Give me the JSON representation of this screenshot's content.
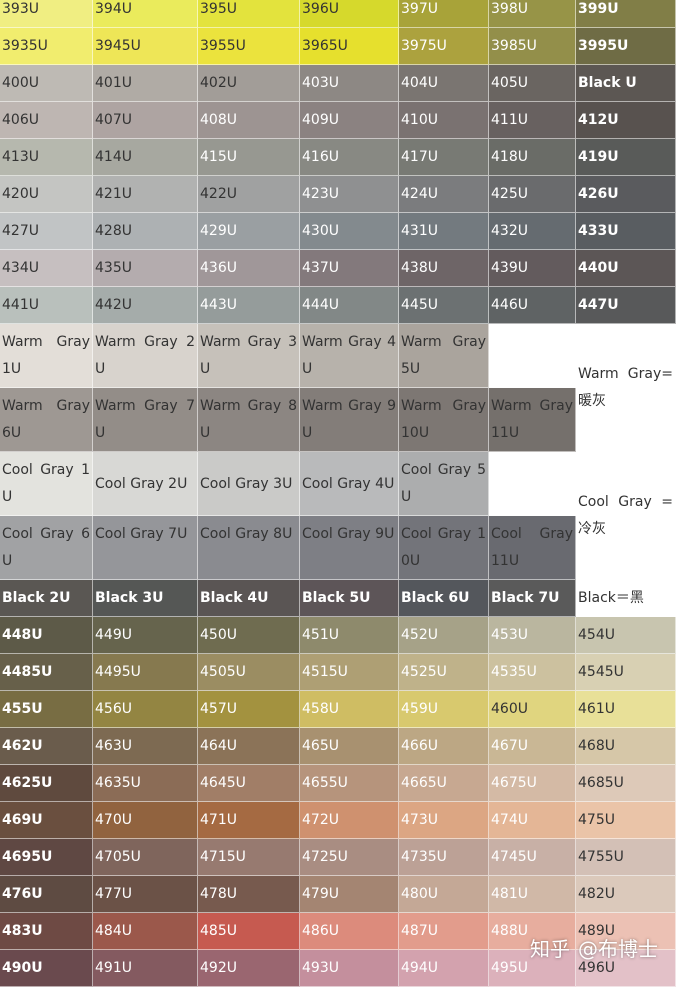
{
  "columns": 7,
  "rows": [
    {
      "cells": [
        {
          "label": "393U",
          "bg": "#f0ee82",
          "text": "light"
        },
        {
          "label": "394U",
          "bg": "#eaeb5c",
          "text": "light"
        },
        {
          "label": "395U",
          "bg": "#e3e33d",
          "text": "light"
        },
        {
          "label": "396U",
          "bg": "#d6d92c",
          "text": "light"
        },
        {
          "label": "397U",
          "bg": "#a8a339",
          "text": "dark"
        },
        {
          "label": "398U",
          "bg": "#979447",
          "text": "dark"
        },
        {
          "label": "399U",
          "bg": "#817e47",
          "text": "dark",
          "bold": true
        }
      ]
    },
    {
      "cells": [
        {
          "label": "3935U",
          "bg": "#f1ed6e",
          "text": "light"
        },
        {
          "label": "3945U",
          "bg": "#eee657",
          "text": "light"
        },
        {
          "label": "3955U",
          "bg": "#ebe33d",
          "text": "light"
        },
        {
          "label": "3965U",
          "bg": "#e6e02d",
          "text": "light"
        },
        {
          "label": "3975U",
          "bg": "#aca23e",
          "text": "dark"
        },
        {
          "label": "3985U",
          "bg": "#938f4a",
          "text": "dark"
        },
        {
          "label": "3995U",
          "bg": "#6f6c45",
          "text": "dark",
          "bold": true
        }
      ]
    },
    {
      "cells": [
        {
          "label": "400U",
          "bg": "#bebab4",
          "text": "light"
        },
        {
          "label": "401U",
          "bg": "#b0aba5",
          "text": "light"
        },
        {
          "label": "402U",
          "bg": "#a29d98",
          "text": "light"
        },
        {
          "label": "403U",
          "bg": "#8d8884",
          "text": "dark"
        },
        {
          "label": "404U",
          "bg": "#7a7571",
          "text": "dark"
        },
        {
          "label": "405U",
          "bg": "#6a6561",
          "text": "dark"
        },
        {
          "label": "Black U",
          "bg": "#5c5753",
          "text": "dark",
          "bold": true
        }
      ]
    },
    {
      "cells": [
        {
          "label": "406U",
          "bg": "#beb6b2",
          "text": "light"
        },
        {
          "label": "407U",
          "bg": "#aea4a2",
          "text": "light"
        },
        {
          "label": "408U",
          "bg": "#9d9492",
          "text": "dark"
        },
        {
          "label": "409U",
          "bg": "#8b8281",
          "text": "dark"
        },
        {
          "label": "410U",
          "bg": "#7a7271",
          "text": "dark"
        },
        {
          "label": "411U",
          "bg": "#686160",
          "text": "dark"
        },
        {
          "label": "412U",
          "bg": "#58524f",
          "text": "dark",
          "bold": true
        }
      ]
    },
    {
      "cells": [
        {
          "label": "413U",
          "bg": "#b6b8ae",
          "text": "light"
        },
        {
          "label": "414U",
          "bg": "#a7a8a0",
          "text": "light"
        },
        {
          "label": "415U",
          "bg": "#979891",
          "text": "dark"
        },
        {
          "label": "416U",
          "bg": "#888983",
          "text": "dark"
        },
        {
          "label": "417U",
          "bg": "#787a74",
          "text": "dark"
        },
        {
          "label": "418U",
          "bg": "#6a6c67",
          "text": "dark"
        },
        {
          "label": "419U",
          "bg": "#595b59",
          "text": "dark",
          "bold": true
        }
      ]
    },
    {
      "cells": [
        {
          "label": "420U",
          "bg": "#c4c5c2",
          "text": "light"
        },
        {
          "label": "421U",
          "bg": "#b1b2b1",
          "text": "light"
        },
        {
          "label": "422U",
          "bg": "#a0a1a1",
          "text": "light"
        },
        {
          "label": "423U",
          "bg": "#8f9091",
          "text": "dark"
        },
        {
          "label": "424U",
          "bg": "#7b7c7e",
          "text": "dark"
        },
        {
          "label": "425U",
          "bg": "#6a6b6d",
          "text": "dark"
        },
        {
          "label": "426U",
          "bg": "#5a5b5e",
          "text": "dark",
          "bold": true
        }
      ]
    },
    {
      "cells": [
        {
          "label": "427U",
          "bg": "#c1c4c5",
          "text": "light"
        },
        {
          "label": "428U",
          "bg": "#adb1b3",
          "text": "light"
        },
        {
          "label": "429U",
          "bg": "#9a9fa2",
          "text": "dark"
        },
        {
          "label": "430U",
          "bg": "#838a8e",
          "text": "dark"
        },
        {
          "label": "431U",
          "bg": "#737a7f",
          "text": "dark"
        },
        {
          "label": "432U",
          "bg": "#656b70",
          "text": "dark"
        },
        {
          "label": "433U",
          "bg": "#595d61",
          "text": "dark",
          "bold": true
        }
      ]
    },
    {
      "cells": [
        {
          "label": "434U",
          "bg": "#c6bfc0",
          "text": "light"
        },
        {
          "label": "435U",
          "bg": "#b4acae",
          "text": "light"
        },
        {
          "label": "436U",
          "bg": "#a09799",
          "text": "dark"
        },
        {
          "label": "437U",
          "bg": "#83797c",
          "text": "dark"
        },
        {
          "label": "438U",
          "bg": "#6e6567",
          "text": "dark"
        },
        {
          "label": "439U",
          "bg": "#635b5d",
          "text": "dark"
        },
        {
          "label": "440U",
          "bg": "#5c5656",
          "text": "dark",
          "bold": true
        }
      ]
    },
    {
      "cells": [
        {
          "label": "441U",
          "bg": "#b9c0bc",
          "text": "light"
        },
        {
          "label": "442U",
          "bg": "#a5acaa",
          "text": "light"
        },
        {
          "label": "443U",
          "bg": "#959c9b",
          "text": "dark"
        },
        {
          "label": "444U",
          "bg": "#828887",
          "text": "dark"
        },
        {
          "label": "445U",
          "bg": "#6c7172",
          "text": "dark"
        },
        {
          "label": "446U",
          "bg": "#5f6364",
          "text": "dark"
        },
        {
          "label": "447U",
          "bg": "#58595a",
          "text": "dark",
          "bold": true
        }
      ]
    }
  ],
  "grays": [
    {
      "cells": [
        {
          "label": "Warm Gray 1U",
          "bg": "#e3ded8",
          "text": "light"
        },
        {
          "label": "Warm Gray 2U",
          "bg": "#d8d3cd",
          "text": "light"
        },
        {
          "label": "Warm Gray 3U",
          "bg": "#c6c1ba",
          "text": "light"
        },
        {
          "label": "Warm Gray 4U",
          "bg": "#b7b2ab",
          "text": "light"
        },
        {
          "label": "Warm Gray 5U",
          "bg": "#aaa49d",
          "text": "light"
        },
        {
          "label": "",
          "bg": "#ffffff",
          "text": "light"
        },
        {
          "label": "Warm Gray=暖灰",
          "bg": "#ffffff",
          "text": "light",
          "span": 2
        }
      ]
    },
    {
      "cells": [
        {
          "label": "Warm Gray 6U",
          "bg": "#9e9893",
          "text": "light"
        },
        {
          "label": "Warm Gray 7U",
          "bg": "#938d88",
          "text": "light"
        },
        {
          "label": "Warm Gray 8U",
          "bg": "#8c8682",
          "text": "light"
        },
        {
          "label": "Warm Gray 9U",
          "bg": "#837d79",
          "text": "light"
        },
        {
          "label": "Warm Gray 10U",
          "bg": "#7d7773",
          "text": "light"
        },
        {
          "label": "Warm Gray 11U",
          "bg": "#75706c",
          "text": "light"
        }
      ]
    },
    {
      "cells": [
        {
          "label": "Cool Gray 1U",
          "bg": "#e3e3de",
          "text": "light"
        },
        {
          "label": "Cool Gray 2U",
          "bg": "#d8d8d5",
          "text": "light"
        },
        {
          "label": "Cool Gray 3U",
          "bg": "#cacac8",
          "text": "light"
        },
        {
          "label": "Cool Gray 4U",
          "bg": "#b9babb",
          "text": "light"
        },
        {
          "label": "Cool Gray 5U",
          "bg": "#acadae",
          "text": "light"
        },
        {
          "label": "",
          "bg": "#ffffff",
          "text": "light"
        },
        {
          "label": "Cool Gray =冷灰",
          "bg": "#ffffff",
          "text": "light",
          "span": 2
        }
      ]
    },
    {
      "cells": [
        {
          "label": "Cool Gray 6U",
          "bg": "#a1a2a4",
          "text": "light"
        },
        {
          "label": "Cool Gray 7U",
          "bg": "#95969a",
          "text": "light"
        },
        {
          "label": "Cool Gray 8U",
          "bg": "#8a8b90",
          "text": "light"
        },
        {
          "label": "Cool Gray 9U",
          "bg": "#7e7f85",
          "text": "light"
        },
        {
          "label": "Cool Gray 10U",
          "bg": "#73747a",
          "text": "light"
        },
        {
          "label": "Cool Gray 11U",
          "bg": "#696a70",
          "text": "light"
        }
      ]
    },
    {
      "cells": [
        {
          "label": "Black 2U",
          "bg": "#5a5753",
          "text": "dark",
          "bold": true
        },
        {
          "label": "Black 3U",
          "bg": "#555755",
          "text": "dark",
          "bold": true
        },
        {
          "label": "Black 4U",
          "bg": "#5a5554",
          "text": "dark",
          "bold": true
        },
        {
          "label": "Black 5U",
          "bg": "#5d5558",
          "text": "dark",
          "bold": true
        },
        {
          "label": "Black 6U",
          "bg": "#54575c",
          "text": "dark",
          "bold": true
        },
        {
          "label": "Black 7U",
          "bg": "#5a5a5a",
          "text": "dark",
          "bold": true
        },
        {
          "label": "Black＝黑",
          "bg": "#ffffff",
          "text": "light"
        }
      ]
    }
  ],
  "bottom": [
    {
      "cells": [
        {
          "label": "448U",
          "bg": "#5d5a48",
          "text": "dark",
          "bold": true
        },
        {
          "label": "449U",
          "bg": "#66644d",
          "text": "dark"
        },
        {
          "label": "450U",
          "bg": "#6f6c50",
          "text": "dark"
        },
        {
          "label": "451U",
          "bg": "#8e8a6c",
          "text": "dark"
        },
        {
          "label": "452U",
          "bg": "#a6a288",
          "text": "dark"
        },
        {
          "label": "453U",
          "bg": "#bab69f",
          "text": "dark"
        },
        {
          "label": "454U",
          "bg": "#c8c5af",
          "text": "light"
        }
      ]
    },
    {
      "cells": [
        {
          "label": "4485U",
          "bg": "#67604a",
          "text": "dark",
          "bold": true
        },
        {
          "label": "4495U",
          "bg": "#86794f",
          "text": "dark"
        },
        {
          "label": "4505U",
          "bg": "#9b8d62",
          "text": "dark"
        },
        {
          "label": "4515U",
          "bg": "#ae9f74",
          "text": "dark"
        },
        {
          "label": "4525U",
          "bg": "#bfb28a",
          "text": "dark"
        },
        {
          "label": "4535U",
          "bg": "#ccc19f",
          "text": "dark"
        },
        {
          "label": "4545U",
          "bg": "#d8d0b3",
          "text": "light"
        }
      ]
    },
    {
      "cells": [
        {
          "label": "455U",
          "bg": "#786d43",
          "text": "dark",
          "bold": true
        },
        {
          "label": "456U",
          "bg": "#938542",
          "text": "dark"
        },
        {
          "label": "457U",
          "bg": "#a3923f",
          "text": "dark"
        },
        {
          "label": "458U",
          "bg": "#cfbd63",
          "text": "dark"
        },
        {
          "label": "459U",
          "bg": "#d8c96e",
          "text": "dark"
        },
        {
          "label": "460U",
          "bg": "#e0d57f",
          "text": "light"
        },
        {
          "label": "461U",
          "bg": "#e8e098",
          "text": "light"
        }
      ]
    },
    {
      "cells": [
        {
          "label": "462U",
          "bg": "#6a5c4c",
          "text": "dark",
          "bold": true
        },
        {
          "label": "463U",
          "bg": "#7d6a52",
          "text": "dark"
        },
        {
          "label": "464U",
          "bg": "#8b7358",
          "text": "dark"
        },
        {
          "label": "465U",
          "bg": "#a89170",
          "text": "dark"
        },
        {
          "label": "466U",
          "bg": "#bca784",
          "text": "dark"
        },
        {
          "label": "467U",
          "bg": "#c9b795",
          "text": "dark"
        },
        {
          "label": "468U",
          "bg": "#d6c7a8",
          "text": "light"
        }
      ]
    },
    {
      "cells": [
        {
          "label": "4625U",
          "bg": "#5f4a3e",
          "text": "dark",
          "bold": true
        },
        {
          "label": "4635U",
          "bg": "#8b6c56",
          "text": "dark"
        },
        {
          "label": "4645U",
          "bg": "#a17e67",
          "text": "dark"
        },
        {
          "label": "4655U",
          "bg": "#b6947c",
          "text": "dark"
        },
        {
          "label": "4665U",
          "bg": "#c7a891",
          "text": "dark"
        },
        {
          "label": "4675U",
          "bg": "#d4baa5",
          "text": "dark"
        },
        {
          "label": "4685U",
          "bg": "#ddc9b8",
          "text": "light"
        }
      ]
    },
    {
      "cells": [
        {
          "label": "469U",
          "bg": "#6a4f3f",
          "text": "dark",
          "bold": true
        },
        {
          "label": "470U",
          "bg": "#91633f",
          "text": "dark"
        },
        {
          "label": "471U",
          "bg": "#a56a42",
          "text": "dark"
        },
        {
          "label": "472U",
          "bg": "#cf916f",
          "text": "dark"
        },
        {
          "label": "473U",
          "bg": "#dca683",
          "text": "dark"
        },
        {
          "label": "474U",
          "bg": "#e4b696",
          "text": "dark"
        },
        {
          "label": "475U",
          "bg": "#eac4a8",
          "text": "light"
        }
      ]
    },
    {
      "cells": [
        {
          "label": "4695U",
          "bg": "#5f4843",
          "text": "dark",
          "bold": true
        },
        {
          "label": "4705U",
          "bg": "#7f655c",
          "text": "dark"
        },
        {
          "label": "4715U",
          "bg": "#977a70",
          "text": "dark"
        },
        {
          "label": "4725U",
          "bg": "#a98d82",
          "text": "dark"
        },
        {
          "label": "4735U",
          "bg": "#bca196",
          "text": "dark"
        },
        {
          "label": "4745U",
          "bg": "#c8b0a6",
          "text": "dark"
        },
        {
          "label": "4755U",
          "bg": "#d3c0b6",
          "text": "light"
        }
      ]
    },
    {
      "cells": [
        {
          "label": "476U",
          "bg": "#5e4b42",
          "text": "dark",
          "bold": true
        },
        {
          "label": "477U",
          "bg": "#6b5247",
          "text": "dark"
        },
        {
          "label": "478U",
          "bg": "#775a4e",
          "text": "dark"
        },
        {
          "label": "479U",
          "bg": "#a48572",
          "text": "dark"
        },
        {
          "label": "480U",
          "bg": "#c4a896",
          "text": "dark"
        },
        {
          "label": "481U",
          "bg": "#d0b8a7",
          "text": "dark"
        },
        {
          "label": "482U",
          "bg": "#dbc9bb",
          "text": "light"
        }
      ]
    },
    {
      "cells": [
        {
          "label": "483U",
          "bg": "#6e4a44",
          "text": "dark",
          "bold": true
        },
        {
          "label": "484U",
          "bg": "#9b584b",
          "text": "dark"
        },
        {
          "label": "485U",
          "bg": "#c65a50",
          "text": "dark"
        },
        {
          "label": "486U",
          "bg": "#dc8b7c",
          "text": "dark"
        },
        {
          "label": "487U",
          "bg": "#e29c8c",
          "text": "dark"
        },
        {
          "label": "488U",
          "bg": "#e7ad9e",
          "text": "dark"
        },
        {
          "label": "489U",
          "bg": "#ecc1b4",
          "text": "light"
        }
      ]
    },
    {
      "cells": [
        {
          "label": "490U",
          "bg": "#6a4a4e",
          "text": "dark",
          "bold": true
        },
        {
          "label": "491U",
          "bg": "#845a60",
          "text": "dark"
        },
        {
          "label": "492U",
          "bg": "#9a6670",
          "text": "dark"
        },
        {
          "label": "493U",
          "bg": "#c48f9d",
          "text": "dark"
        },
        {
          "label": "494U",
          "bg": "#d3a2ae",
          "text": "dark"
        },
        {
          "label": "495U",
          "bg": "#dcb1bb",
          "text": "dark"
        },
        {
          "label": "496U",
          "bg": "#e3c1c8",
          "text": "light"
        }
      ]
    }
  ],
  "watermark": {
    "site": "知乎",
    "author": "@布博士"
  }
}
